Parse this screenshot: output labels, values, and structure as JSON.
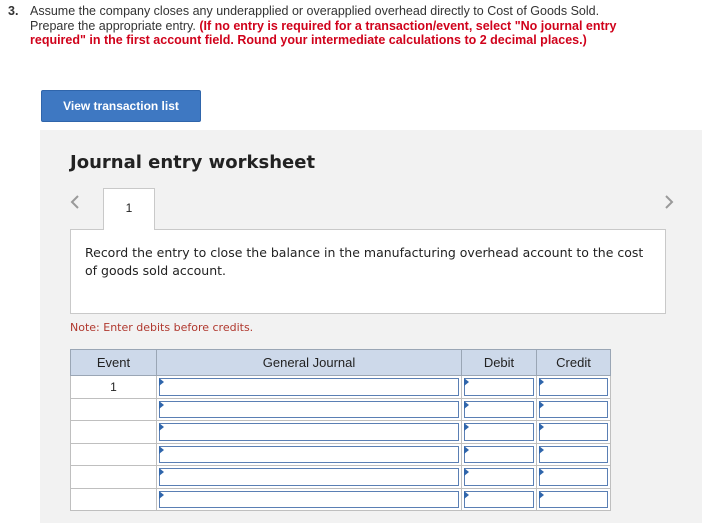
{
  "question": {
    "number": "3.",
    "text": "Assume the company closes any underapplied or overapplied overhead directly to Cost of Goods Sold. Prepare the appropriate entry.",
    "instruction": "(If no entry is required for a transaction/event, select \"No journal entry required\" in the first account field. Round your intermediate calculations to 2 decimal places.)"
  },
  "view_button_label": "View transaction list",
  "worksheet": {
    "title": "Journal entry worksheet",
    "tab_label": "1",
    "prompt": "Record the entry to close the balance in the manufacturing overhead account to the cost of goods sold account.",
    "note": "Note: Enter debits before credits."
  },
  "table": {
    "headers": [
      "Event",
      "General Journal",
      "Debit",
      "Credit"
    ],
    "rows": [
      {
        "event": "1",
        "account": "",
        "debit": "",
        "credit": ""
      },
      {
        "event": "",
        "account": "",
        "debit": "",
        "credit": ""
      },
      {
        "event": "",
        "account": "",
        "debit": "",
        "credit": ""
      },
      {
        "event": "",
        "account": "",
        "debit": "",
        "credit": ""
      },
      {
        "event": "",
        "account": "",
        "debit": "",
        "credit": ""
      },
      {
        "event": "",
        "account": "",
        "debit": "",
        "credit": ""
      }
    ]
  },
  "icons": {
    "prev": "chevron-left-icon",
    "next": "chevron-right-icon"
  }
}
